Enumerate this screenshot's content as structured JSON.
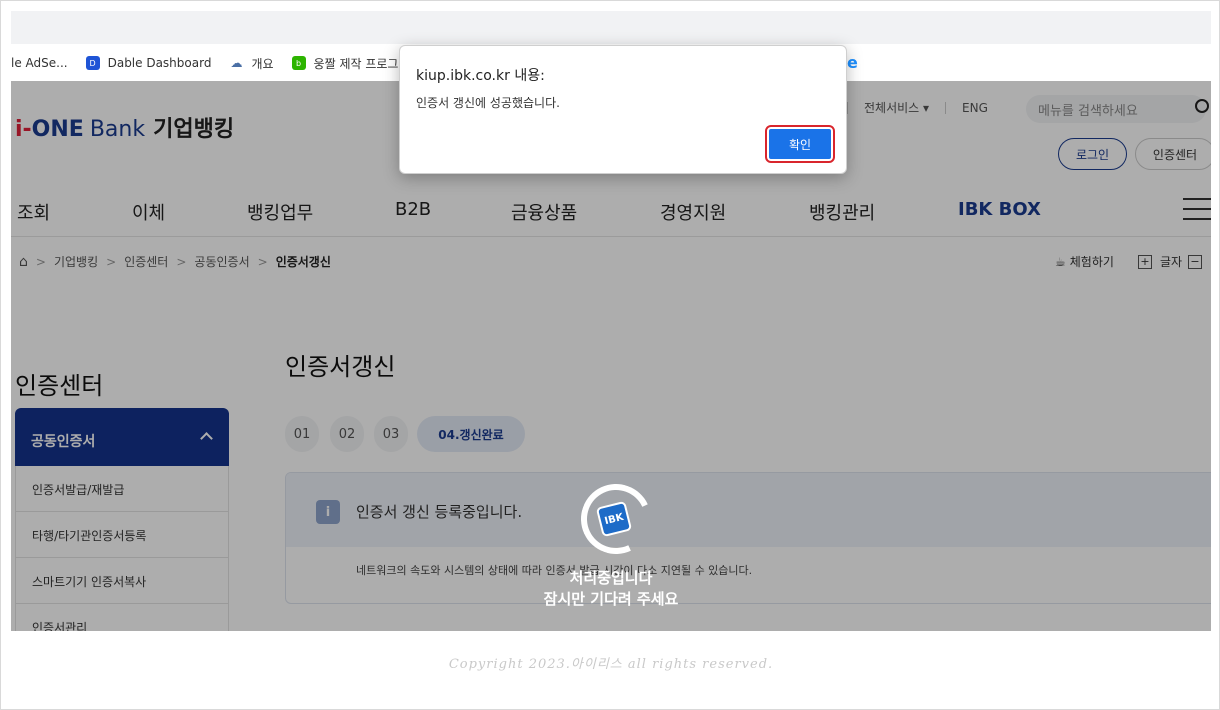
{
  "bookmarks": [
    {
      "label": "le AdSe...",
      "icon": "blank-icon"
    },
    {
      "label": "Dable Dashboard",
      "icon": "dable-icon"
    },
    {
      "label": "개요",
      "icon": "cloud-icon"
    },
    {
      "label": "웅짤 제작 프로그램",
      "icon": "blog-icon"
    }
  ],
  "header": {
    "logo_prefix": "i-",
    "logo_one": "ONE",
    "logo_bank": "Bank",
    "logo_kor": "기업뱅킹",
    "all_services": "전체서비스 ▾",
    "lang": "ENG",
    "search_placeholder": "메뉴를 검색하세요",
    "login": "로그인",
    "cert_center": "인증센터"
  },
  "gnb": [
    "조회",
    "이체",
    "뱅킹업무",
    "B2B",
    "금융상품",
    "경영지원",
    "뱅킹관리",
    "IBK BOX"
  ],
  "breadcrumb": [
    "기업뱅킹",
    "인증센터",
    "공동인증서",
    "인증서갱신"
  ],
  "utility": {
    "experience": "체험하기",
    "text_size": "글자"
  },
  "lnb": {
    "title": "인증센터",
    "section": "공동인증서",
    "items": [
      "인증서발급/재발급",
      "타행/타기관인증서등록",
      "스마트기기 인증서복사",
      "인증서관리"
    ]
  },
  "content": {
    "title": "인증서갱신",
    "steps": [
      "01",
      "02",
      "03",
      "04.갱신완료"
    ],
    "info_icon": "i",
    "info_title": "인증서 갱신 등록중입니다.",
    "info_desc": "네트워크의 속도와 시스템의 상태에 따라 인증서 발급 시간이 다소 지연될 수 있습니다."
  },
  "loading": {
    "logo": "IBK",
    "line1": "처리중입니다",
    "line2": "잠시만 기다려 주세요"
  },
  "dialog": {
    "origin": "kiup.ibk.co.kr 내용:",
    "message": "인증서 갱신에 성공했습니다.",
    "ok": "확인"
  },
  "footer": {
    "copyright": "Copyright 2023.아이리스 all rights reserved."
  },
  "colors": {
    "brand": "#1b3c8f",
    "accent_red": "#e0213a",
    "dialog_button": "#1a73e8"
  }
}
